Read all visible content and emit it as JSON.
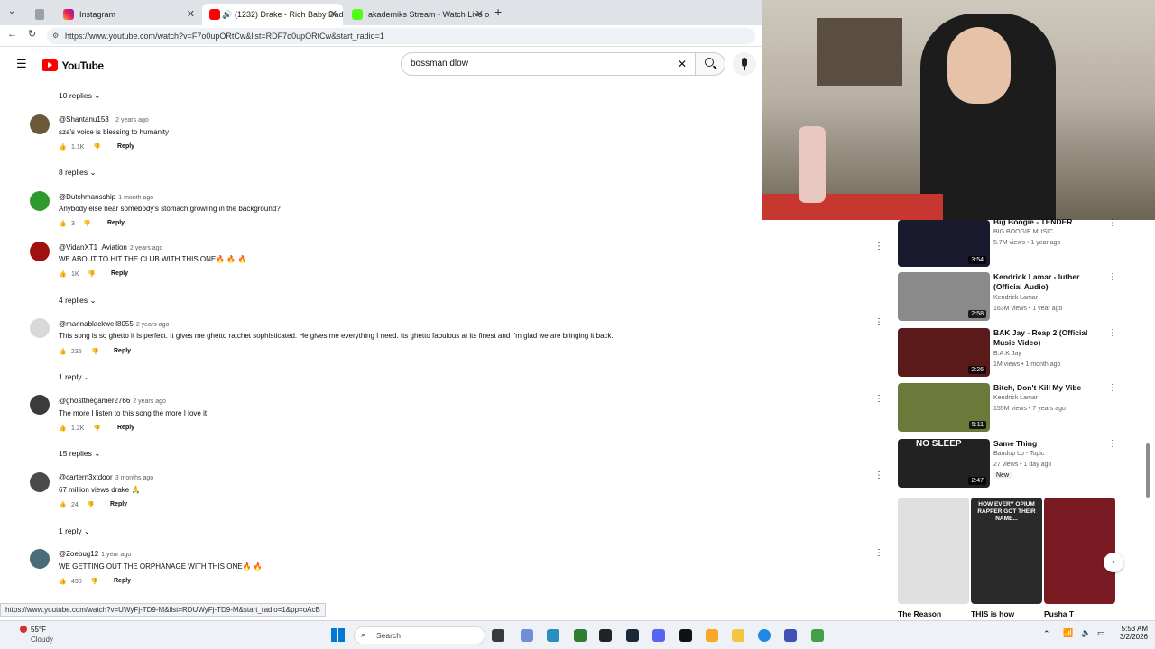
{
  "browser": {
    "tabs": [
      {
        "title": "Instagram"
      },
      {
        "title": "(1232) Drake - Rich Baby Dadd"
      },
      {
        "title": "akademiks Stream - Watch Live on"
      }
    ],
    "url": "https://www.youtube.com/watch?v=F7o0upORtCw&list=RDF7o0upORtCw&start_radio=1",
    "status_url": "https://www.youtube.com/watch?v=UWyFj-TD9-M&list=RDUWyFj-TD9-M&start_radio=1&pp=oAcB"
  },
  "youtube": {
    "logo": "YouTube",
    "search_value": "bossman dlow"
  },
  "comments": [
    {
      "replies_above": "10 replies"
    },
    {
      "author": "@Shantanu153_",
      "when": "2 years ago",
      "text": "sza's voice is blessing to humanity",
      "likes": "1.1K",
      "reply": "Reply",
      "replies": "8 replies"
    },
    {
      "author": "@Dutchmansship",
      "when": "1 month ago",
      "text": "Anybody else hear somebody's stomach growling in the background?",
      "likes": "3",
      "reply": "Reply"
    },
    {
      "author": "@VidanXT1_Aviation",
      "when": "2 years ago",
      "text": "WE ABOUT TO HIT THE CLUB WITH THIS ONE🔥 🔥 🔥",
      "likes": "1K",
      "reply": "Reply",
      "replies": "4 replies"
    },
    {
      "author": "@marinablackwell8055",
      "when": "2 years ago",
      "text": "This song is so ghetto it is perfect. It gives me ghetto ratchet sophisticated. He gives me everything I need.  Its ghetto fabulous at its finest and I'm glad we are bringing it back.",
      "likes": "235",
      "reply": "Reply",
      "replies": "1 reply"
    },
    {
      "author": "@ghostthegamer2766",
      "when": "2 years ago",
      "text": "The more I listen to this song the more I love it",
      "likes": "1.2K",
      "reply": "Reply",
      "replies": "15 replies"
    },
    {
      "author": "@cartern3xtdoor",
      "when": "3 months ago",
      "text": "67 million views drake 🙏",
      "likes": "24",
      "reply": "Reply",
      "replies": "1 reply"
    },
    {
      "author": "@Zoebug12",
      "when": "1 year ago",
      "text": "WE GETTING OUT THE ORPHANAGE WITH THIS ONE🔥 🔥",
      "likes": "450",
      "reply": "Reply"
    }
  ],
  "sidebar": {
    "videos": [
      {
        "title": "Big Boogie - TENDER",
        "channel": "BIG BOOGIE MUSIC",
        "meta": "5.7M views • 1 year ago",
        "duration": "3:54"
      },
      {
        "title": "Kendrick Lamar - luther (Official Audio)",
        "channel": "Kendrick Lamar",
        "meta": "163M views • 1 year ago",
        "duration": "2:58"
      },
      {
        "title": "BAK Jay - Reap 2 (Official Music Video)",
        "channel": "B.A.K Jay",
        "meta": "1M views • 1 month ago",
        "duration": "2:26"
      },
      {
        "title": "Bitch, Don't Kill My Vibe",
        "channel": "Kendrick Lamar",
        "meta": "155M views • 7 years ago",
        "duration": "5:11"
      },
      {
        "title": "Same Thing",
        "channel": "Bandup Lp - Topic",
        "meta": "27 views • 1 day ago",
        "badge": "New",
        "duration": "2:47",
        "thumb_text": "NO SLEEP"
      }
    ],
    "shorts": [
      {
        "title": "The Reason"
      },
      {
        "title": "THIS is how",
        "thumb_text": "HOW EVERY OPIUM RAPPER GOT THEIR NAME..."
      },
      {
        "title": "Pusha T"
      }
    ]
  },
  "taskbar": {
    "weather_temp": "55°F",
    "weather_desc": "Cloudy",
    "search_label": "Search",
    "time": "5:53 AM",
    "date": "3/2/2026"
  }
}
